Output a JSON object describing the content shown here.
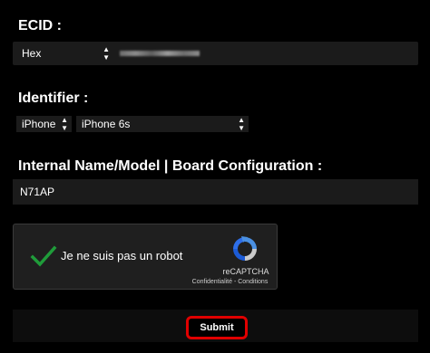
{
  "ecid": {
    "label": "ECID :",
    "format_select": "Hex"
  },
  "identifier": {
    "label": "Identifier :",
    "device_type": "iPhone",
    "model": "iPhone 6s"
  },
  "board": {
    "label": "Internal Name/Model | Board Configuration :",
    "value": "N71AP"
  },
  "captcha": {
    "text": "Je ne suis pas un robot",
    "brand": "reCAPTCHA",
    "links": "Confidentialité - Conditions",
    "check_color": "#1f9c3a"
  },
  "submit": {
    "label": "Submit",
    "highlight_color": "#e00000"
  }
}
